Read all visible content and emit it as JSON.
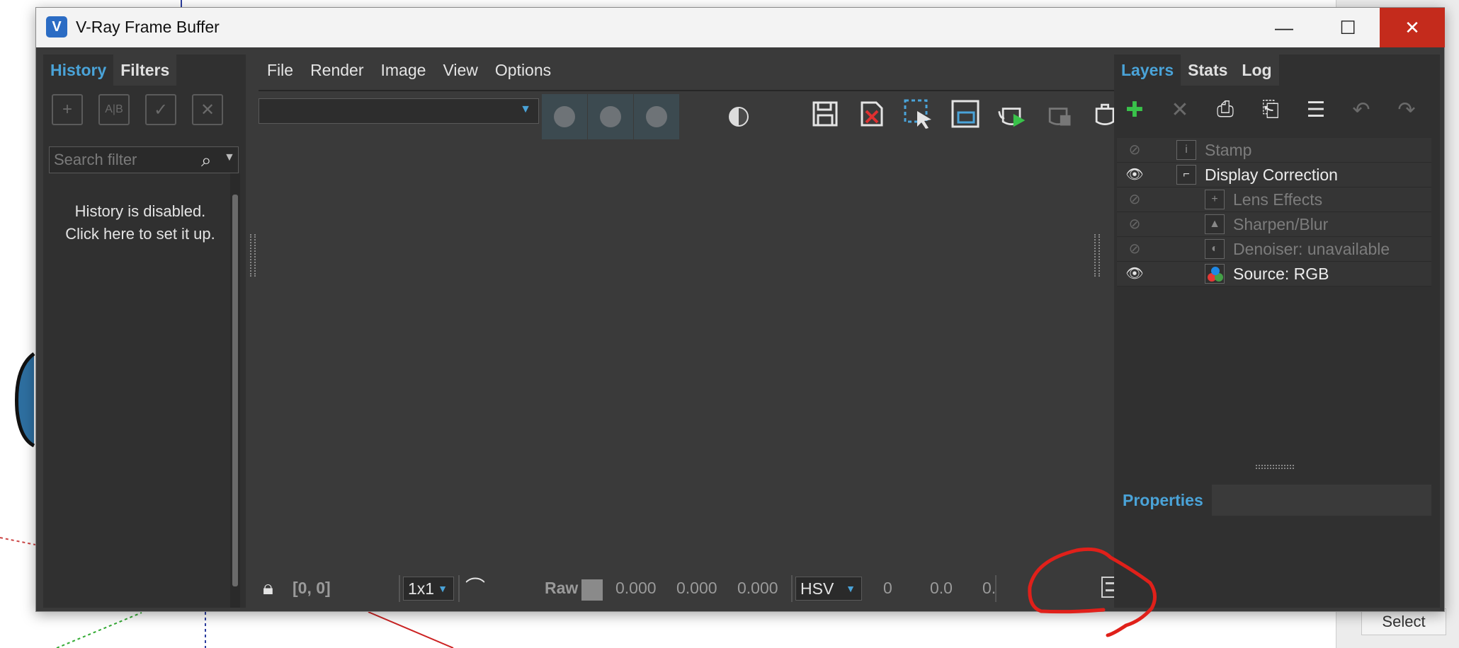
{
  "window": {
    "title": "V-Ray Frame Buffer",
    "min_glyph": "—",
    "max_glyph": "☐",
    "close_glyph": "✕",
    "app_icon_glyph": "V"
  },
  "left_panel": {
    "tabs": [
      {
        "label": "History",
        "active": true
      },
      {
        "label": "Filters",
        "active": false
      }
    ],
    "toolbar_icons": [
      "add-history-icon",
      "ab-compare-icon",
      "load-history-icon",
      "remove-history-icon"
    ],
    "search": {
      "placeholder": "Search filter",
      "value": ""
    },
    "message_line1": "History is disabled.",
    "message_line2": "Click here to set it up."
  },
  "center": {
    "menu": [
      "File",
      "Render",
      "Image",
      "View",
      "Options"
    ],
    "render_select_value": "",
    "toolbar_icons": [
      "save-image-icon",
      "clear-image-icon",
      "region-render-icon",
      "render-frame-icon",
      "start-render-icon",
      "stop-render-icon",
      "render-teapot-icon"
    ],
    "status": {
      "coords": "[0, 0]",
      "sample_size": "1x1",
      "mode": "Raw",
      "r": "0.000",
      "g": "0.000",
      "b": "0.000",
      "color_space": "HSV",
      "h": "0",
      "s": "0.0",
      "v": "0."
    }
  },
  "right_panel": {
    "tabs": [
      {
        "label": "Layers",
        "active": true
      },
      {
        "label": "Stats",
        "active": false
      },
      {
        "label": "Log",
        "active": false
      }
    ],
    "layers": [
      {
        "name": "Stamp",
        "visible": false,
        "indent": 0
      },
      {
        "name": "Display Correction",
        "visible": true,
        "indent": 0
      },
      {
        "name": "Lens Effects",
        "visible": false,
        "indent": 1
      },
      {
        "name": "Sharpen/Blur",
        "visible": false,
        "indent": 1
      },
      {
        "name": "Denoiser: unavailable",
        "visible": false,
        "indent": 1
      },
      {
        "name": "Source: RGB",
        "visible": true,
        "indent": 1
      }
    ],
    "properties_label": "Properties"
  },
  "background": {
    "select_button": "Select"
  },
  "colors": {
    "accent": "#4aa3d8",
    "close": "#c42b1c",
    "annotation": "#e0201a"
  }
}
